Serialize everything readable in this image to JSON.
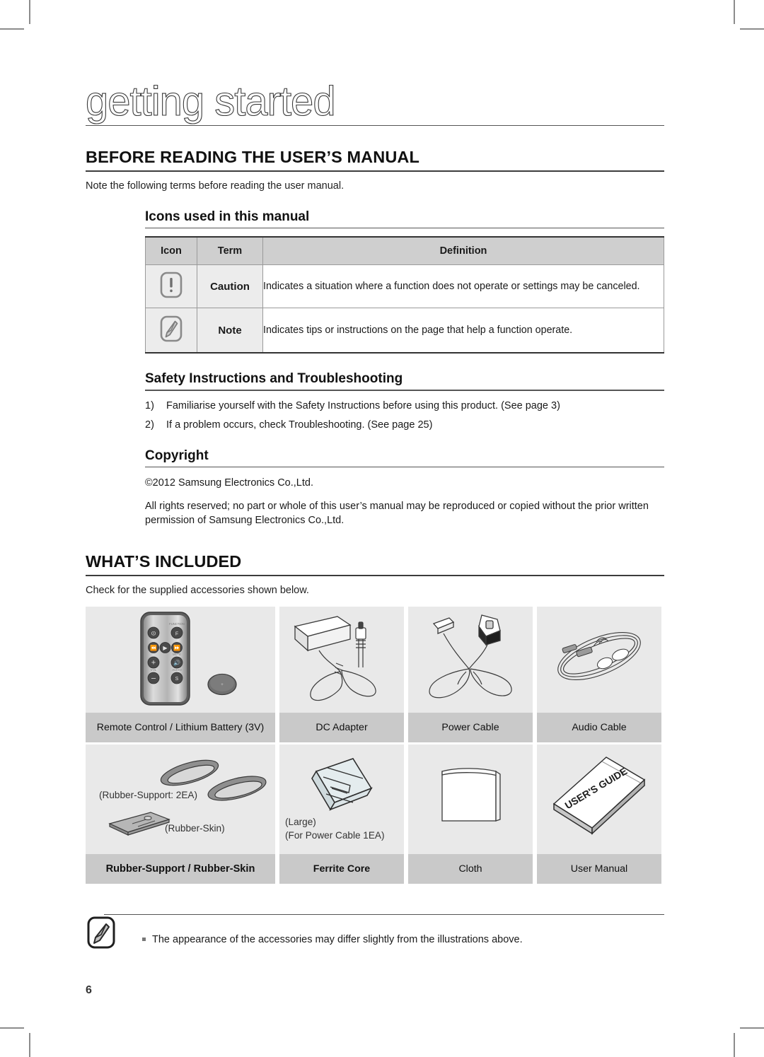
{
  "document": {
    "chapter_title": "getting started",
    "page_number": "6"
  },
  "section_before_reading": {
    "heading": "BEFORE READING THE USER’S MANUAL",
    "intro": "Note the following terms before reading the user manual.",
    "icons_subheading": "Icons used in this manual",
    "icons_table": {
      "headers": [
        "Icon",
        "Term",
        "Definition"
      ],
      "rows": [
        {
          "icon_name": "caution-icon",
          "term": "Caution",
          "definition": "Indicates a situation where a function does not operate or settings may be canceled."
        },
        {
          "icon_name": "note-icon",
          "term": "Note",
          "definition": "Indicates tips or instructions on the page that help a function operate."
        }
      ]
    },
    "safety_subheading": "Safety Instructions and Troubleshooting",
    "safety_items": [
      {
        "num": "1)",
        "text": "Familiarise yourself with the Safety Instructions before using this product. (See page 3)"
      },
      {
        "num": "2)",
        "text": "If a problem occurs, check Troubleshooting. (See page 25)"
      }
    ],
    "copyright_subheading": "Copyright",
    "copyright_line1": "©2012 Samsung Electronics Co.,Ltd.",
    "copyright_line2": "All rights reserved; no part or whole of this user’s manual may be reproduced or copied without the prior written permission of Samsung Electronics Co.,Ltd."
  },
  "section_whats_included": {
    "heading": "WHAT’S INCLUDED",
    "intro": "Check for the supplied accessories shown below.",
    "accessories": [
      {
        "caption": "Remote Control / Lithium Battery (3V)",
        "sub_labels": []
      },
      {
        "caption": "DC Adapter",
        "sub_labels": []
      },
      {
        "caption": "Power Cable",
        "sub_labels": []
      },
      {
        "caption": "Audio Cable",
        "sub_labels": []
      },
      {
        "caption": "Rubber-Support / Rubber-Skin",
        "sub_labels": [
          "(Rubber-Support: 2EA)",
          "(Rubber-Skin)"
        ]
      },
      {
        "caption": "Ferrite Core",
        "sub_labels": [
          "(Large)",
          "(For Power Cable 1EA)"
        ]
      },
      {
        "caption": "Cloth",
        "sub_labels": []
      },
      {
        "caption": "User Manual",
        "sub_labels": [
          "USER'S GUIDE"
        ]
      }
    ],
    "footer_note": "The appearance of the accessories may differ slightly from the illustrations above."
  },
  "colors": {
    "table_header_bg": "#cfcfcf",
    "table_cell_bg": "#ececec",
    "accessory_image_bg": "#e9e9e9",
    "accessory_caption_bg": "#c9c9c9",
    "rule": "#555555"
  }
}
